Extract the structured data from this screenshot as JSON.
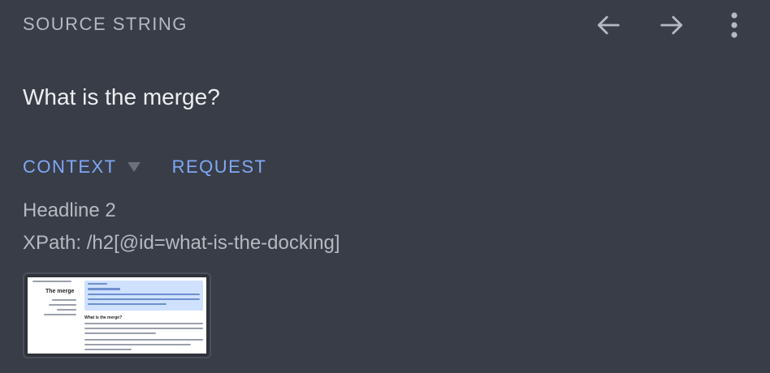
{
  "header": {
    "title": "SOURCE STRING",
    "icons": [
      "arrow-left-icon",
      "arrow-right-icon",
      "more-vertical-icon"
    ]
  },
  "source": {
    "text": "What is the merge?"
  },
  "tabs": [
    {
      "label": "CONTEXT",
      "has_dropdown": true
    },
    {
      "label": "REQUEST",
      "has_dropdown": false
    }
  ],
  "context": {
    "element_type": "Headline 2",
    "xpath": "XPath: /h2[@id=what-is-the-docking]"
  },
  "thumbnail": {
    "title": "The merge",
    "heading": "What is the merge?"
  },
  "colors": {
    "background": "#393d47",
    "accent": "#7fa8f5",
    "text_primary": "#eceef1",
    "text_secondary": "#b5b9c1"
  }
}
